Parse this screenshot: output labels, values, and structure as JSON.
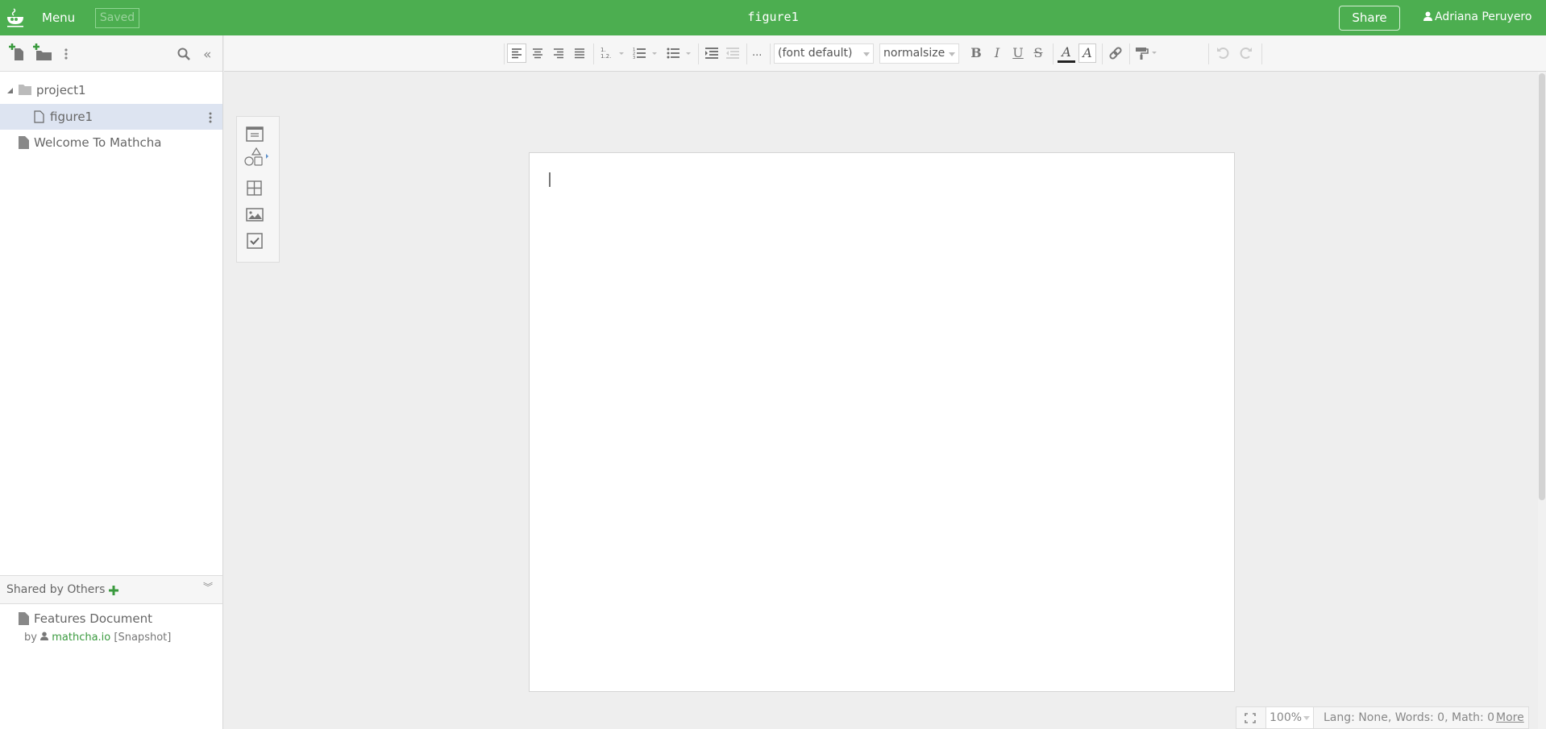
{
  "topbar": {
    "menu_label": "Menu",
    "save_status": "Saved",
    "document_title": "figure1",
    "share_label": "Share",
    "user_name": "Adriana Peruyero",
    "brand_color": "#4cae50"
  },
  "sidebar": {
    "tree": [
      {
        "label": "project1",
        "type": "folder",
        "expanded": true
      },
      {
        "label": "figure1",
        "type": "document",
        "selected": true
      },
      {
        "label": "Welcome To Mathcha",
        "type": "document"
      }
    ],
    "shared_header": "Shared by Others",
    "shared_items": [
      {
        "label": "Features Document",
        "by_prefix": "by",
        "author": "mathcha.io",
        "tag": "[Snapshot]"
      }
    ]
  },
  "toolbar": {
    "font_select": "(font default)",
    "size_select": "normalsize",
    "more_label": "...",
    "bold": "B",
    "italic": "I",
    "underline": "U",
    "strike": "S",
    "text_color_glyph": "A",
    "highlight_glyph": "A"
  },
  "statusbar": {
    "zoom_value": "100%",
    "info": "Lang: None, Words: 0, Math: 0",
    "more_label": "More"
  }
}
